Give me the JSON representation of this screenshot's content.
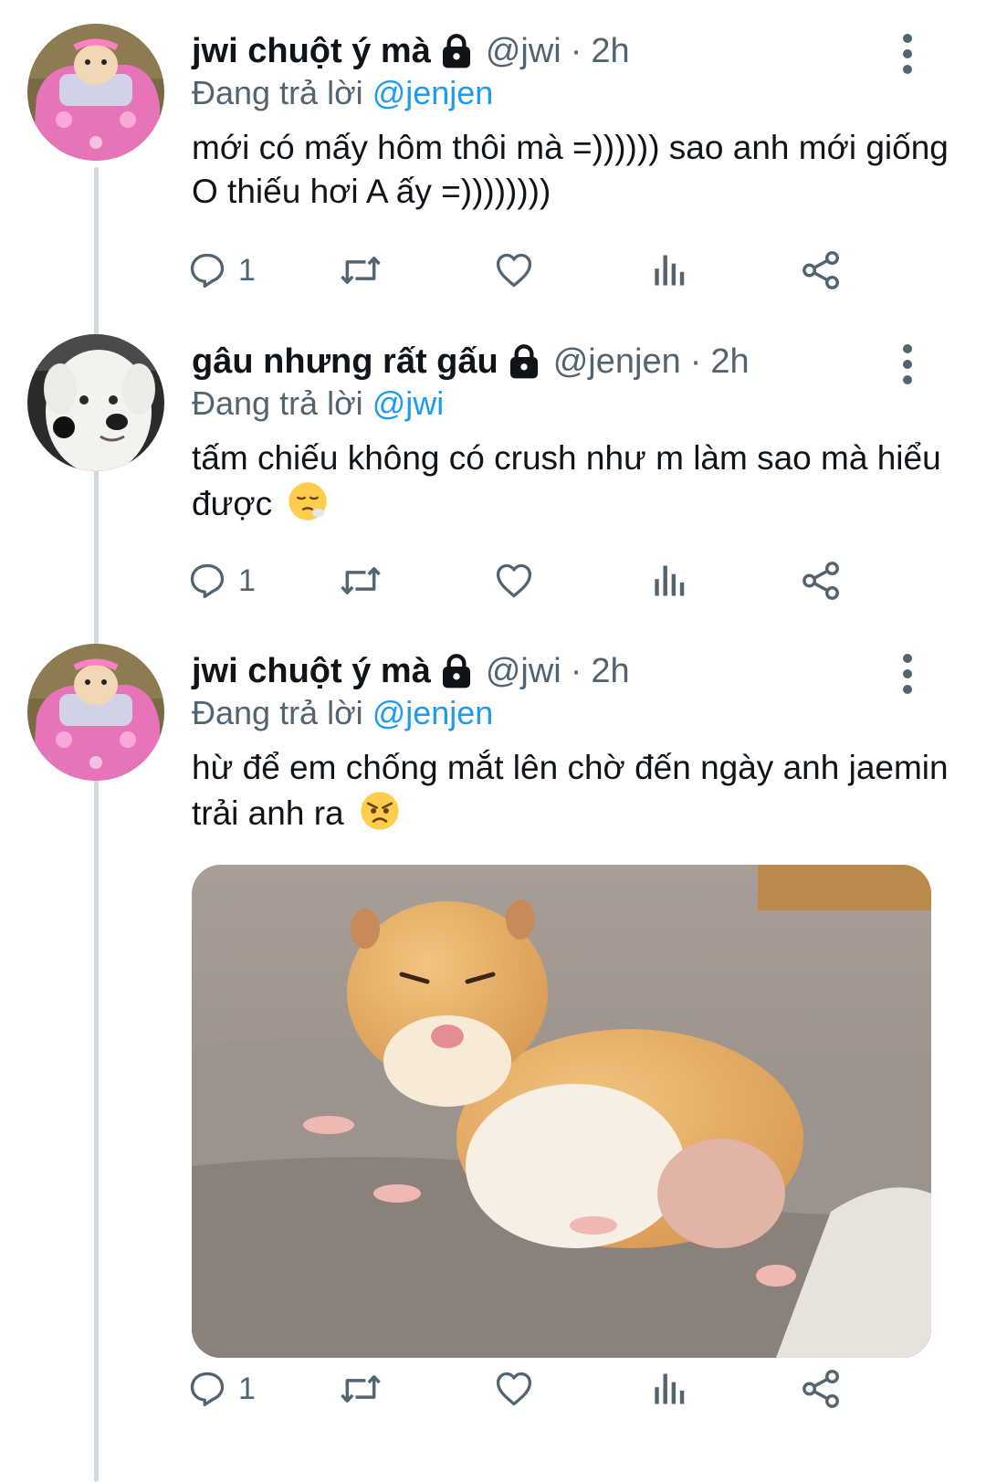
{
  "colors": {
    "text": "#0f1419",
    "secondary": "#536471",
    "link": "#1d9bf0",
    "thread_line": "#cfd9de"
  },
  "tweets": [
    {
      "display_name": "jwi chuột ý mà",
      "lock_icon": "lock-icon",
      "handle": "@jwi",
      "dot": "·",
      "time": "2h",
      "reply_prefix": "Đang trả lời",
      "reply_to": "@jenjen",
      "text": "mới có mấy hôm thôi mà =)))))) sao anh mới giống O thiếu hơi A ấy =))))))))",
      "emoji": "",
      "reply_count": "1"
    },
    {
      "display_name": "gâu nhưng rất gấu",
      "lock_icon": "lock-icon",
      "handle": "@jenjen",
      "dot": "·",
      "time": "2h",
      "reply_prefix": "Đang trả lời",
      "reply_to": "@jwi",
      "text": "tấm chiếu không có crush như m làm sao mà hiểu được",
      "emoji": "sighing-face-emoji",
      "reply_count": "1"
    },
    {
      "display_name": "jwi chuột ý mà",
      "lock_icon": "lock-icon",
      "handle": "@jwi",
      "dot": "·",
      "time": "2h",
      "reply_prefix": "Đang trả lời",
      "reply_to": "@jenjen",
      "text": "hừ để em chống mắt lên chờ đến ngày anh jaemin trải anh ra",
      "emoji": "angry-face-emoji",
      "reply_count": "1",
      "media": "hamster-photo"
    }
  ]
}
